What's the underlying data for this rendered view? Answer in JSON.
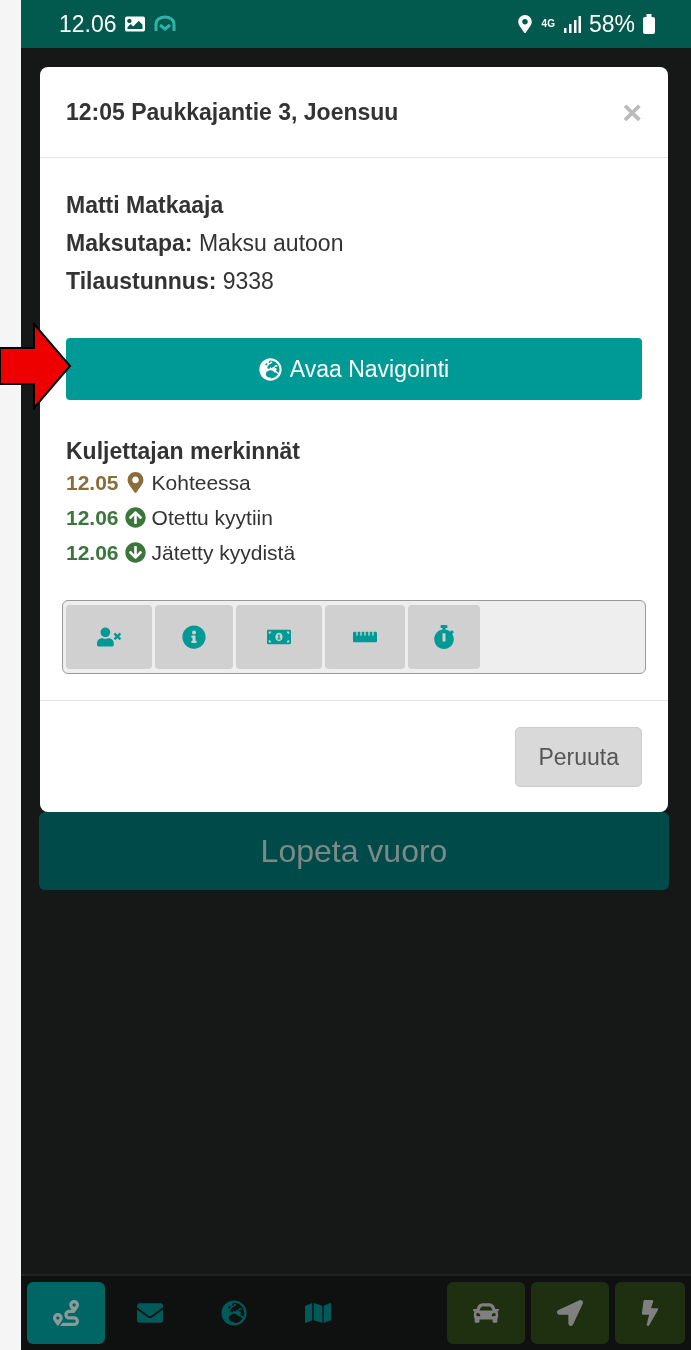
{
  "status_bar": {
    "time": "12.06",
    "network": "4G",
    "battery": "58%"
  },
  "background": {
    "end_shift_button": "Lopeta vuoro"
  },
  "modal": {
    "title": "12:05 Paukkajantie 3, Joensuu",
    "close": "×",
    "passenger": "Matti Matkaaja",
    "details": [
      "**Maksutapa:** Maksu autoon",
      "**Tilaustunnus:** 9338"
    ],
    "navigate_button": "Avaa Navigointi",
    "notes_heading": "Kuljettajan merkinnät",
    "notes": [
      {
        "kind": "arrival",
        "time": "12.05",
        "text": "Kohteessa",
        "color": "#8a6d3b"
      },
      {
        "kind": "pickup",
        "time": "12.06",
        "text": "Otettu kyytiin",
        "color": "#3c763d"
      },
      {
        "kind": "dropoff",
        "time": "12.06",
        "text": "Jätetty kyydistä",
        "color": "#3c763d"
      }
    ],
    "tools": [
      {
        "kind": "no-show"
      },
      {
        "kind": "info"
      },
      {
        "kind": "payment"
      },
      {
        "kind": "distance"
      },
      {
        "kind": "timer"
      }
    ],
    "cancel_button": "Peruuta"
  },
  "bottom_nav": [
    {
      "kind": "route",
      "selected": true
    },
    {
      "kind": "messages",
      "selected": false
    },
    {
      "kind": "globe",
      "selected": false
    },
    {
      "kind": "map",
      "selected": false
    }
  ],
  "quick_actions": [
    {
      "kind": "car"
    },
    {
      "kind": "navigate"
    },
    {
      "kind": "bolt"
    }
  ]
}
